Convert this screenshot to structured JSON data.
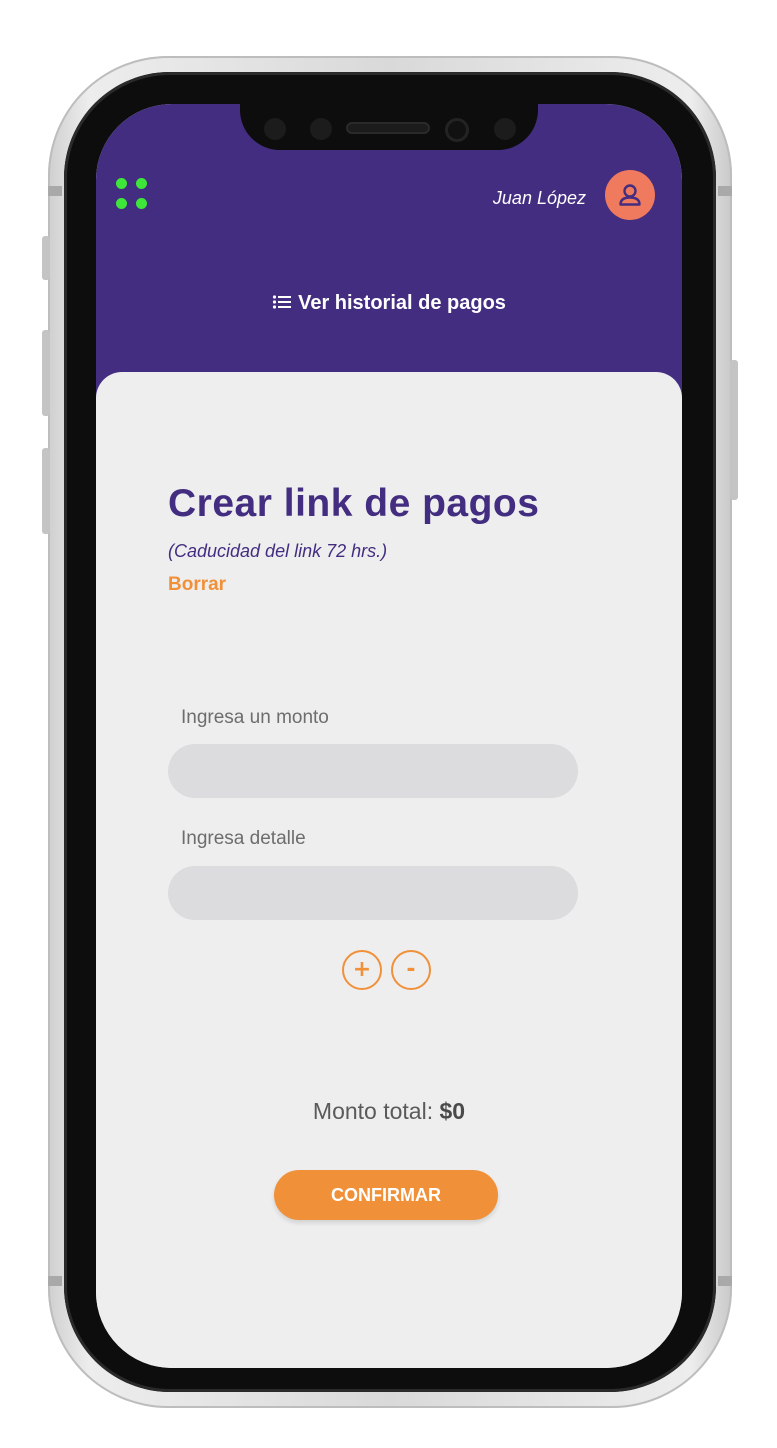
{
  "header": {
    "user_name": "Juan López",
    "history_link_label": "Ver historial de pagos"
  },
  "main": {
    "title": "Crear link de pagos",
    "subtitle": "(Caducidad del link 72 hrs.)",
    "clear_label": "Borrar",
    "fields": [
      {
        "label": "Ingresa un monto",
        "value": "",
        "placeholder": ""
      },
      {
        "label": "Ingresa detalle",
        "value": "",
        "placeholder": ""
      }
    ],
    "add_label": "+",
    "remove_label": "-",
    "total_label": "Monto total:",
    "total_value": "$0",
    "confirm_label": "CONFIRMAR"
  },
  "colors": {
    "header_bg": "#432d80",
    "accent_orange": "#f0913a",
    "avatar_bg": "#f07a5d",
    "menu_green": "#3fe63a",
    "input_bg": "#dcdcde",
    "screen_bg": "#efeeef"
  },
  "icons": {
    "menu": "grid-dots-icon",
    "avatar": "user-icon",
    "history": "list-icon"
  }
}
